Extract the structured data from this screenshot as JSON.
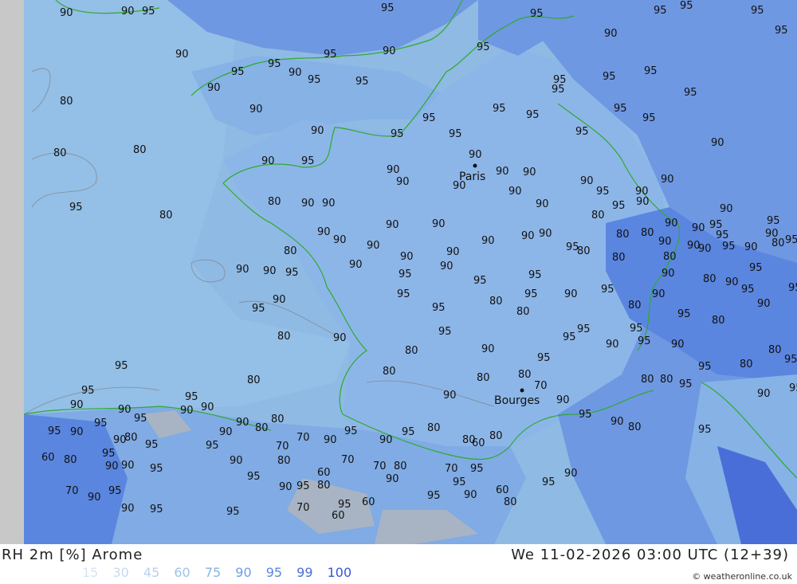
{
  "title": "RH 2m [%] Arome",
  "datetime": "We 11-02-2026 03:00 UTC (12+39)",
  "credit": "© weatheronline.co.uk",
  "legend": [
    {
      "label": "15",
      "color": "#d6e4f5"
    },
    {
      "label": "30",
      "color": "#c8daf2"
    },
    {
      "label": "45",
      "color": "#b8d0ee"
    },
    {
      "label": "60",
      "color": "#9ec4e8"
    },
    {
      "label": "75",
      "color": "#86b4e4"
    },
    {
      "label": "90",
      "color": "#6e9ee2"
    },
    {
      "label": "95",
      "color": "#5a86e0"
    },
    {
      "label": "99",
      "color": "#4a6ed8"
    },
    {
      "label": "100",
      "color": "#3a56d0"
    }
  ],
  "map": {
    "colors": {
      "sea": "#8fbae4",
      "land80": "#9ec4e8",
      "land90": "#7aa6e6",
      "land95": "#5a86e0",
      "land99": "#4a6ed8",
      "grey_edge": "#c8c8c8",
      "low": "#a8b4c4",
      "coast": "#2eaa2e",
      "contour": "#808080"
    },
    "cities": [
      {
        "name": "Paris"
      },
      {
        "name": "Bourges"
      }
    ],
    "labels": [
      "90",
      "90",
      "95",
      "95",
      "95",
      "95",
      "95",
      "95",
      "95",
      "90",
      "95",
      "90",
      "95",
      "90",
      "95",
      "95",
      "95",
      "90",
      "95",
      "80",
      "90",
      "95",
      "95",
      "95",
      "95",
      "95",
      "95",
      "95",
      "95",
      "90",
      "95",
      "95",
      "95",
      "95",
      "90",
      "95",
      "90",
      "90",
      "95",
      "90",
      "80",
      "80",
      "90",
      "90",
      "90",
      "90",
      "90",
      "90",
      "95",
      "90",
      "90",
      "90",
      "95",
      "90",
      "90",
      "95",
      "80",
      "80",
      "90",
      "90",
      "90",
      "90",
      "90",
      "90",
      "90",
      "90",
      "90",
      "90",
      "90",
      "90",
      "95",
      "80",
      "80",
      "90",
      "90",
      "80",
      "90",
      "90",
      "90",
      "95",
      "95",
      "90",
      "95",
      "80",
      "80",
      "90",
      "90",
      "95",
      "90",
      "95",
      "90",
      "95",
      "95",
      "95",
      "80",
      "80",
      "80",
      "90",
      "95",
      "95",
      "90",
      "95",
      "90",
      "80",
      "90",
      "95",
      "90",
      "95",
      "90",
      "95",
      "95",
      "95",
      "80",
      "80",
      "90",
      "95",
      "80",
      "90",
      "95",
      "80",
      "80",
      "90",
      "95",
      "90",
      "95",
      "95",
      "95",
      "90",
      "95",
      "95",
      "90",
      "95",
      "80",
      "80",
      "95",
      "95",
      "80",
      "80",
      "80",
      "90",
      "80",
      "80",
      "70",
      "95",
      "95",
      "90",
      "90",
      "90",
      "95",
      "90",
      "80",
      "80",
      "80",
      "95",
      "95",
      "90",
      "95",
      "90",
      "95",
      "95",
      "90",
      "90",
      "80",
      "95",
      "90",
      "95",
      "95",
      "90",
      "90",
      "80",
      "80",
      "70",
      "90",
      "95",
      "90",
      "95",
      "80",
      "80",
      "60",
      "80",
      "60",
      "80",
      "95",
      "90",
      "90",
      "95",
      "90",
      "70",
      "80",
      "60",
      "70",
      "70",
      "80",
      "70",
      "95",
      "95",
      "90",
      "80",
      "70",
      "90",
      "95",
      "90",
      "95",
      "95",
      "95",
      "90",
      "95",
      "95",
      "60",
      "60",
      "70",
      "95",
      "90",
      "60",
      "80",
      "95",
      "90"
    ]
  }
}
